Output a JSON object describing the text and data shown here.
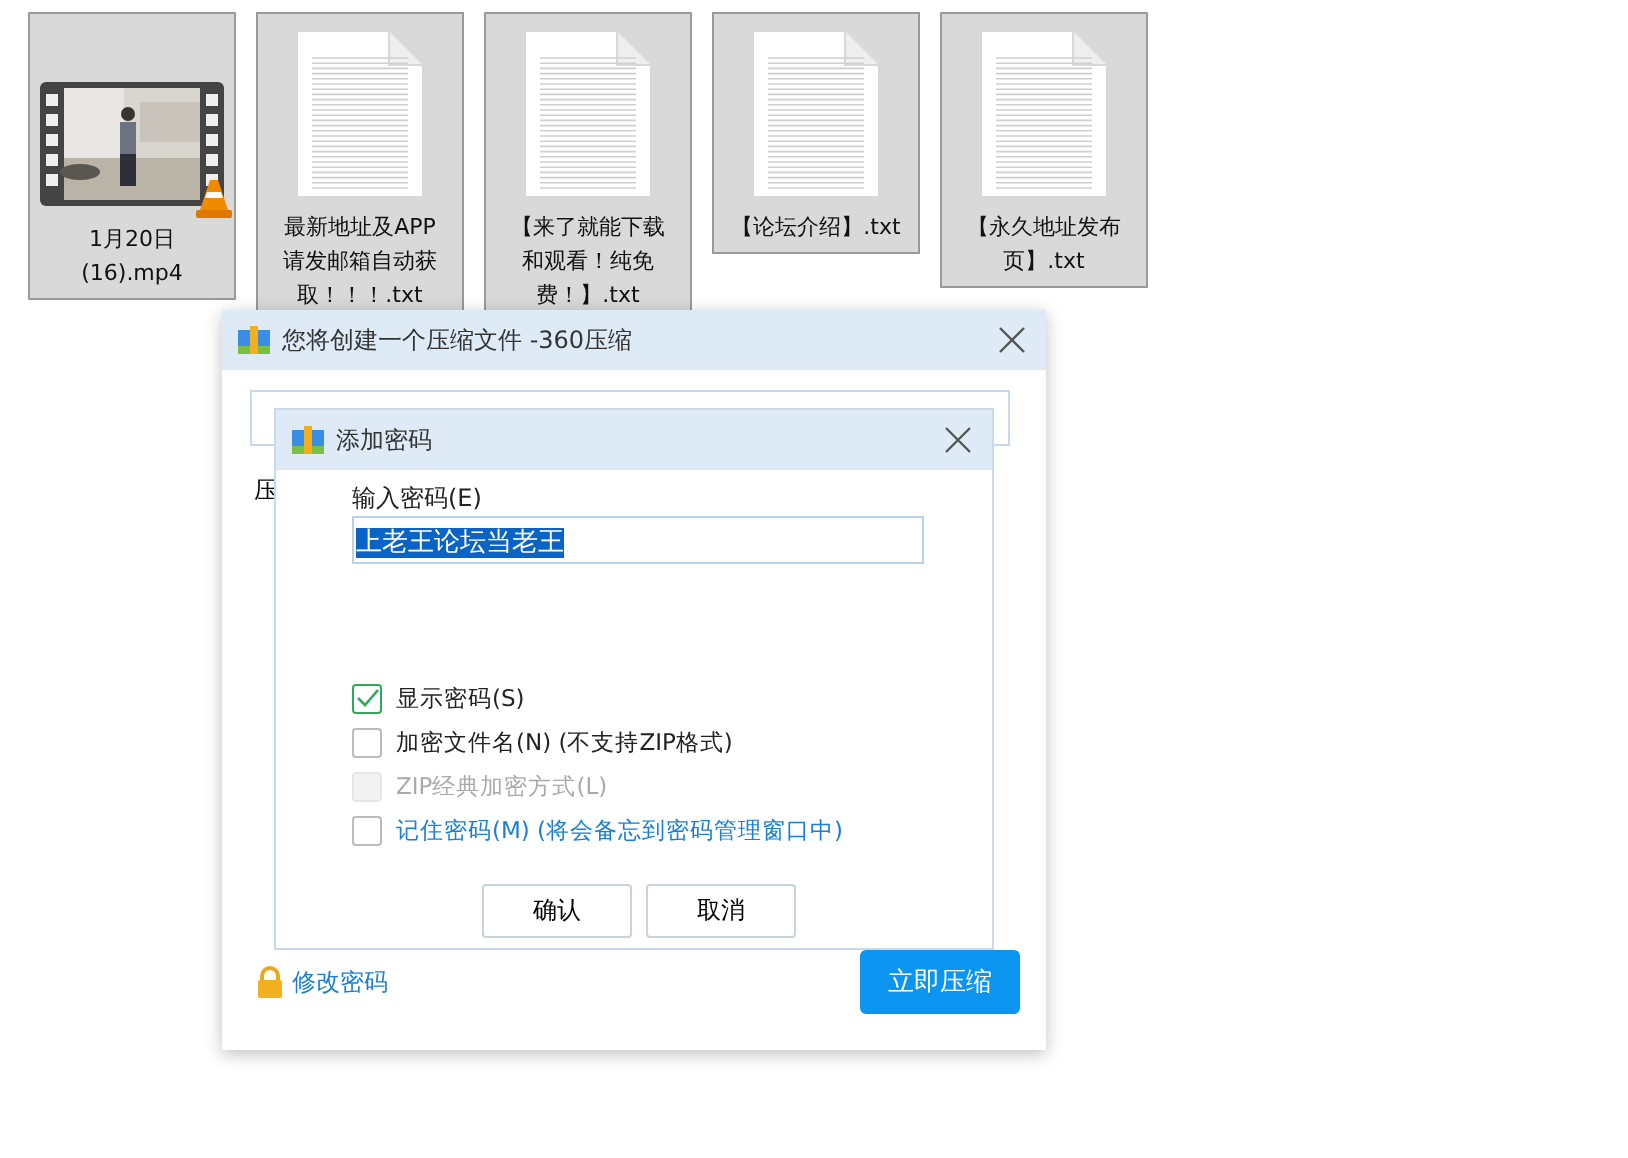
{
  "files": [
    {
      "kind": "video",
      "lines": [
        "1月20日",
        "(16).mp4"
      ]
    },
    {
      "kind": "text",
      "lines": [
        "最新地址及APP",
        "请发邮箱自动获",
        "取！！！.txt"
      ]
    },
    {
      "kind": "text",
      "lines": [
        "【来了就能下载",
        "和观看！纯免",
        "费！】.txt"
      ]
    },
    {
      "kind": "text",
      "lines": [
        "【论坛介绍】.txt"
      ]
    },
    {
      "kind": "text",
      "lines": [
        "【永久地址发布",
        "页】.txt"
      ]
    }
  ],
  "main_dialog": {
    "title": "您将创建一个压缩文件 -360压缩",
    "label": "压",
    "link": "修改密码",
    "button": "立即压缩"
  },
  "password_dialog": {
    "title": "添加密码",
    "field_label": "输入密码(E)",
    "value": "上老王论坛当老王",
    "options": [
      {
        "label": "显示密码(S)",
        "checked": true,
        "disabled": false,
        "link": false
      },
      {
        "label": "加密文件名(N) (不支持ZIP格式)",
        "checked": false,
        "disabled": false,
        "link": false
      },
      {
        "label": "ZIP经典加密方式(L)",
        "checked": false,
        "disabled": true,
        "link": false
      },
      {
        "label": "记住密码(M) (将会备忘到密码管理窗口中)",
        "checked": false,
        "disabled": false,
        "link": true
      }
    ],
    "buttons": [
      "确认",
      "取消"
    ]
  }
}
